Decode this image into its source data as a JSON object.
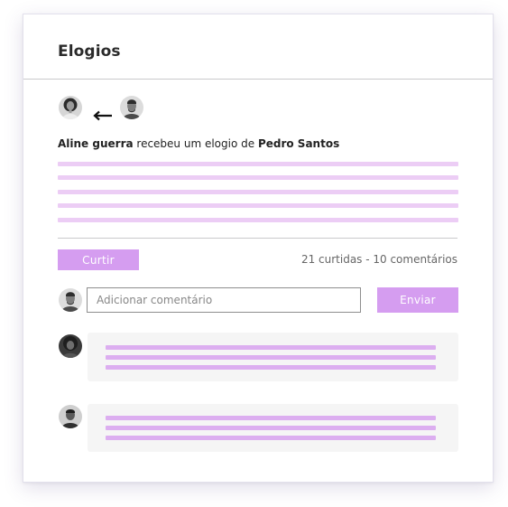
{
  "header": {
    "title": "Elogios"
  },
  "praise": {
    "receiver": "Aline guerra",
    "middle_text": " recebeu um elogio de ",
    "giver": "Pedro Santos"
  },
  "actions": {
    "like_label": "Curtir",
    "stats": "21 curtidas - 10 comentários"
  },
  "comment": {
    "placeholder": "Adicionar comentário",
    "send_label": "Enviar"
  },
  "colors": {
    "accent": "#d59df0",
    "skeleton_light": "#eccdf5",
    "skeleton_comment": "#dcaef0",
    "comment_bg": "#f5f5f5"
  },
  "icons": [
    "arrow-left-icon"
  ]
}
